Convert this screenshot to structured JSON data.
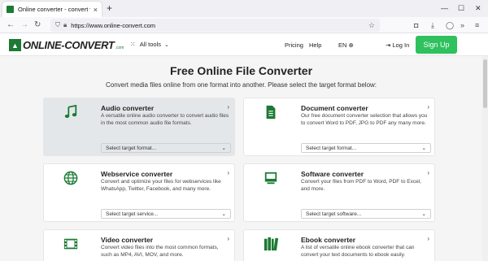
{
  "browser": {
    "tab_title": "Online converter - convert vide",
    "tab_close": "×",
    "new_tab": "+",
    "url": "https://www.online-convert.com",
    "win_min": "—",
    "win_max": "☐",
    "win_close": "✕"
  },
  "site": {
    "logo_mark": "▲",
    "logo_text": "ONLINE-CONVERT",
    "logo_suffix": ".com",
    "all_tools": "All tools",
    "pricing": "Pricing",
    "help": "Help",
    "lang": "EN",
    "login": "Log In",
    "signup": "Sign Up"
  },
  "hero": {
    "title": "Free Online File Converter",
    "subtitle": "Convert media files online from one format into another. Please select the target format below:"
  },
  "cards": [
    {
      "title": "Audio converter",
      "desc": "A versatile online audio converter to convert audio files in the most common audio file formats.",
      "select": "Select target format...",
      "icon": "music-icon"
    },
    {
      "title": "Document converter",
      "desc": "Our free document converter selection that allows you to convert Word to PDF, JPG to PDF any many more.",
      "select": "Select target format...",
      "icon": "document-icon"
    },
    {
      "title": "Webservice converter",
      "desc": "Convert and optimize your files for webservices like WhatsApp, Twitter, Facebook, and many more.",
      "select": "Select target service...",
      "icon": "globe-icon"
    },
    {
      "title": "Software converter",
      "desc": "Convert your files from PDF to Word, PDF to Excel, and more.",
      "select": "Select target software...",
      "icon": "monitor-icon"
    },
    {
      "title": "Video converter",
      "desc": "Convert video files into the most common formats, such as MP4, AVI, MOV, and more.",
      "select": "",
      "icon": "film-icon"
    },
    {
      "title": "Ebook converter",
      "desc": "A list of versatile online ebook converter that can convert your text documents to ebook easily.",
      "select": "",
      "icon": "books-icon"
    }
  ],
  "colors": {
    "brand_green": "#1c7a34",
    "signup_green": "#2ec15d"
  }
}
